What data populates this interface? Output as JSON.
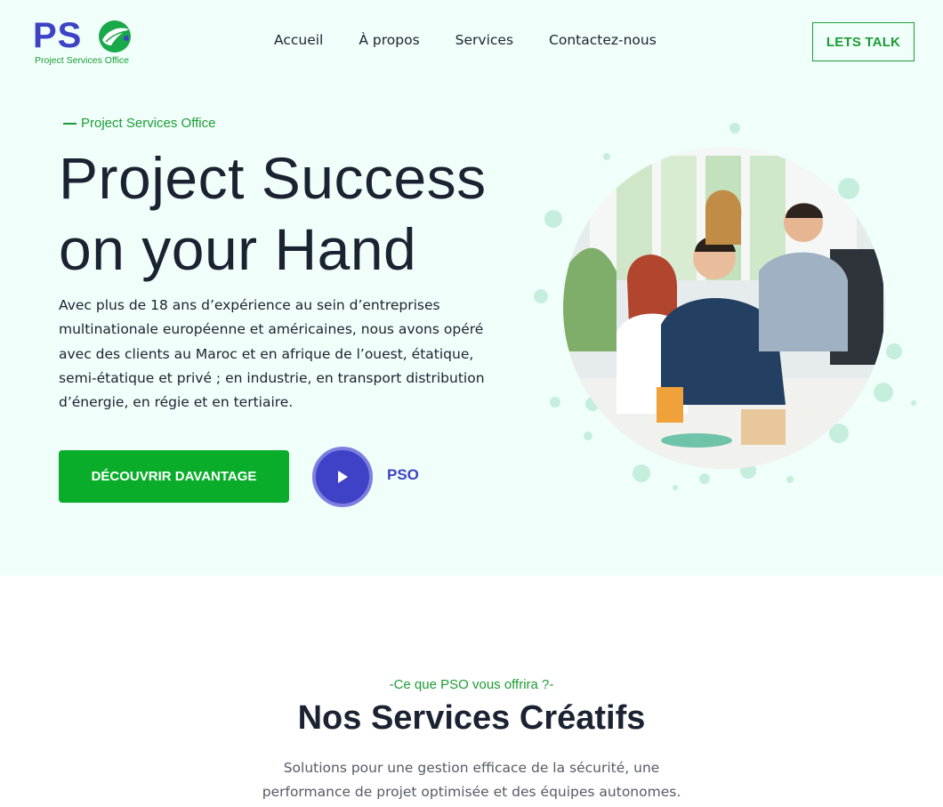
{
  "header": {
    "logo_mark": "PS",
    "logo_tagline": "Project Services Office",
    "nav": [
      {
        "label": "Accueil"
      },
      {
        "label": "À propos"
      },
      {
        "label": "Services"
      },
      {
        "label": "Contactez-nous"
      }
    ],
    "cta_label": "LETS TALK"
  },
  "hero": {
    "eyebrow": "Project Services Office",
    "title": "Project Success on your Hand",
    "description": "Avec plus de 18 ans d’expérience au sein d’entreprises multinationale européenne et américaines, nous avons opéré avec des clients au Maroc et en afrique de l’ouest, étatique, semi-étatique et privé ; en industrie, en transport distribution d’énergie, en régie et en tertiaire.",
    "primary_button": "DÉCOUVRIR DAVANTAGE",
    "video_label": "PSO",
    "image_icon": "team-photo"
  },
  "services": {
    "eyebrow": "-Ce que PSO vous offrira ?-",
    "title": "Nos Services Créatifs",
    "description": "Solutions pour une gestion efficace de la sécurité, une performance de projet optimisée et des équipes autonomes."
  },
  "colors": {
    "brand_blue": "#3e42c4",
    "brand_green": "#1b9c34",
    "button_green": "#0aad2a",
    "hero_bg": "#f1fffb",
    "text_dark": "#1b2231"
  }
}
